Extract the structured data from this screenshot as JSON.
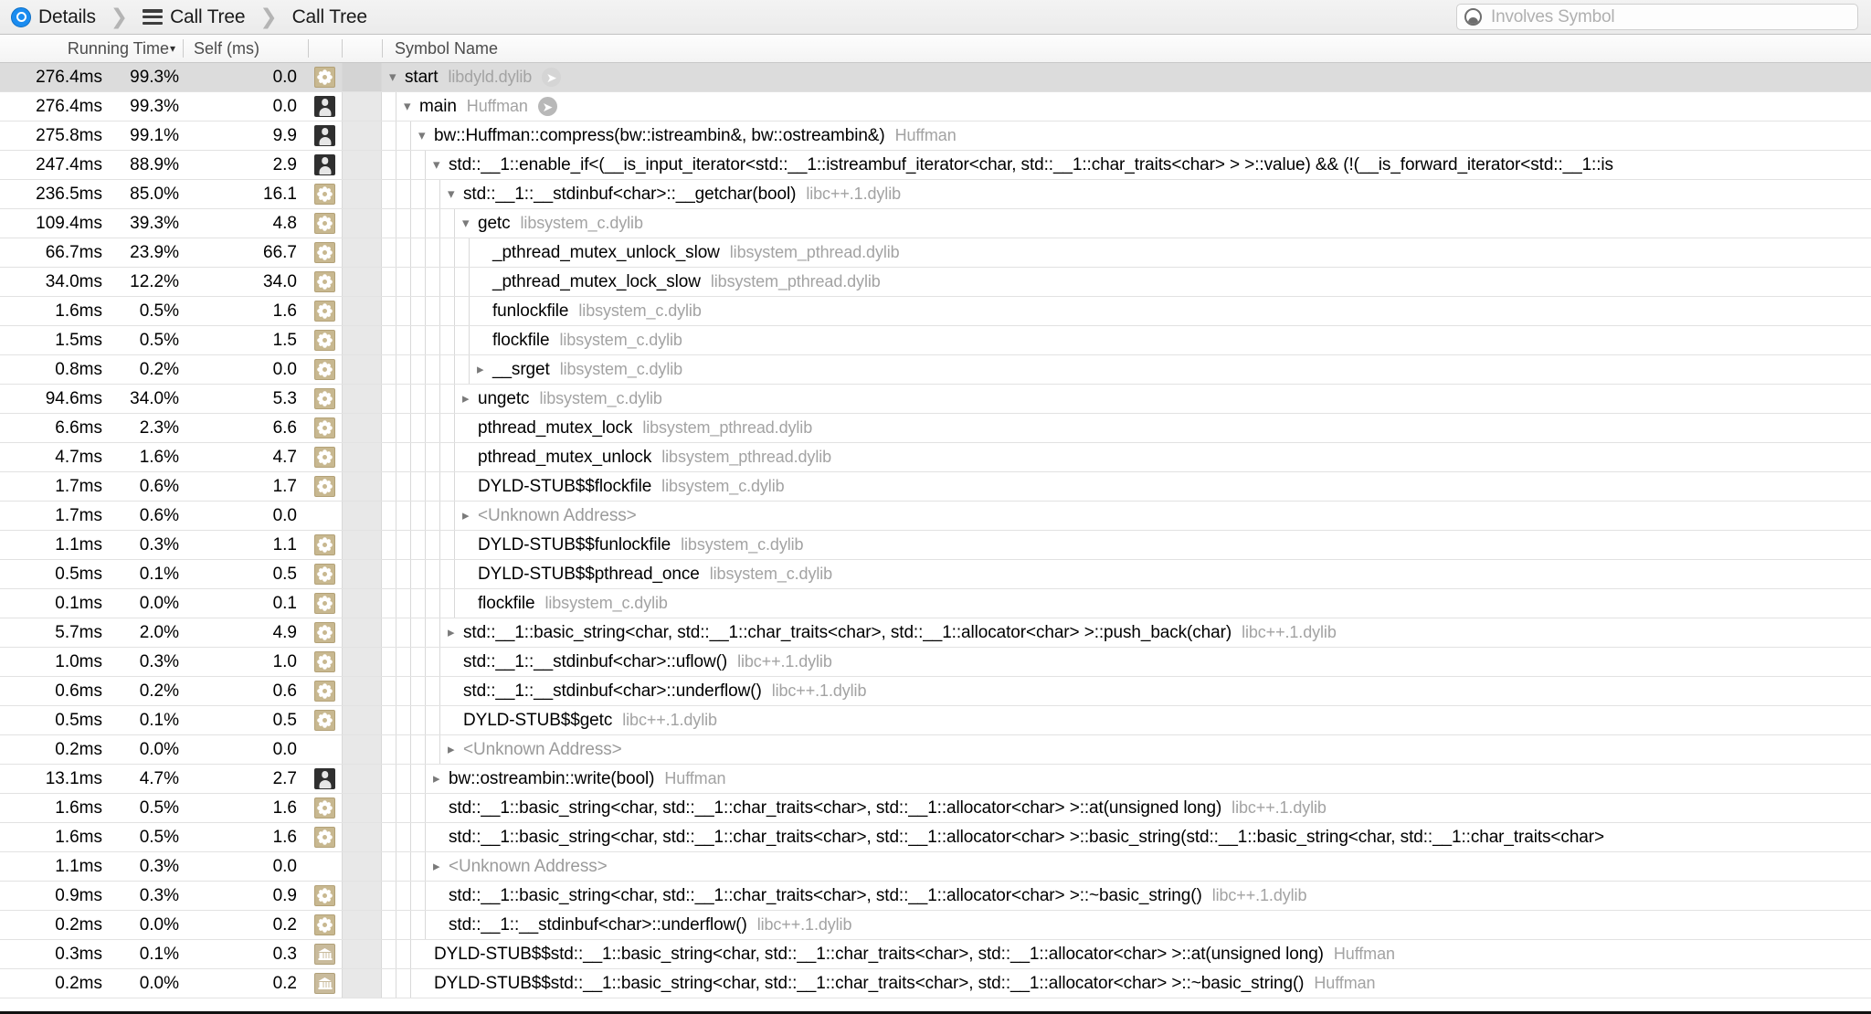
{
  "window": {
    "breadcrumb": [
      {
        "label": "Details",
        "icon": "details-target-icon"
      },
      {
        "label": "Call Tree",
        "icon": "call-tree-icon"
      },
      {
        "label": "Call Tree",
        "icon": null
      }
    ],
    "search": {
      "placeholder": "Involves Symbol",
      "value": "",
      "icon": "symbol-filter-icon"
    }
  },
  "table": {
    "columns": [
      {
        "key": "running_time",
        "label": "Running Time",
        "sorted": true,
        "sort_caret": "▾"
      },
      {
        "key": "self_ms",
        "label": "Self (ms)",
        "sorted": false
      },
      {
        "key": "symbol_name",
        "label": "Symbol Name",
        "sorted": false
      }
    ],
    "rows": [
      {
        "ms": "276.4ms",
        "pct": "99.3%",
        "self": "0.0",
        "icon": "gear",
        "depth": 0,
        "tri": "open",
        "symbol": "start",
        "lib": "libdyld.dylib",
        "go": "pale",
        "selected": true
      },
      {
        "ms": "276.4ms",
        "pct": "99.3%",
        "self": "0.0",
        "icon": "person",
        "depth": 1,
        "tri": "open",
        "symbol": "main",
        "lib": "Huffman",
        "go": "solid",
        "selected": false
      },
      {
        "ms": "275.8ms",
        "pct": "99.1%",
        "self": "9.9",
        "icon": "person",
        "depth": 2,
        "tri": "open",
        "symbol": "bw::Huffman::compress(bw::istreambin&, bw::ostreambin&)",
        "lib": "Huffman",
        "go": null,
        "selected": false
      },
      {
        "ms": "247.4ms",
        "pct": "88.9%",
        "self": "2.9",
        "icon": "person",
        "depth": 3,
        "tri": "open",
        "symbol": "std::__1::enable_if<(__is_input_iterator<std::__1::istreambuf_iterator<char, std::__1::char_traits<char> > >::value) && (!(__is_forward_iterator<std::__1::is",
        "lib": "",
        "go": null,
        "selected": false
      },
      {
        "ms": "236.5ms",
        "pct": "85.0%",
        "self": "16.1",
        "icon": "gear",
        "depth": 4,
        "tri": "open",
        "symbol": "std::__1::__stdinbuf<char>::__getchar(bool)",
        "lib": "libc++.1.dylib",
        "go": null,
        "selected": false
      },
      {
        "ms": "109.4ms",
        "pct": "39.3%",
        "self": "4.8",
        "icon": "gear",
        "depth": 5,
        "tri": "open",
        "symbol": "getc",
        "lib": "libsystem_c.dylib",
        "go": null,
        "selected": false
      },
      {
        "ms": "66.7ms",
        "pct": "23.9%",
        "self": "66.7",
        "icon": "gear",
        "depth": 6,
        "tri": "none",
        "symbol": "_pthread_mutex_unlock_slow",
        "lib": "libsystem_pthread.dylib",
        "go": null,
        "selected": false
      },
      {
        "ms": "34.0ms",
        "pct": "12.2%",
        "self": "34.0",
        "icon": "gear",
        "depth": 6,
        "tri": "none",
        "symbol": "_pthread_mutex_lock_slow",
        "lib": "libsystem_pthread.dylib",
        "go": null,
        "selected": false
      },
      {
        "ms": "1.6ms",
        "pct": "0.5%",
        "self": "1.6",
        "icon": "gear",
        "depth": 6,
        "tri": "none",
        "symbol": "funlockfile",
        "lib": "libsystem_c.dylib",
        "go": null,
        "selected": false
      },
      {
        "ms": "1.5ms",
        "pct": "0.5%",
        "self": "1.5",
        "icon": "gear",
        "depth": 6,
        "tri": "none",
        "symbol": "flockfile",
        "lib": "libsystem_c.dylib",
        "go": null,
        "selected": false
      },
      {
        "ms": "0.8ms",
        "pct": "0.2%",
        "self": "0.0",
        "icon": "gear",
        "depth": 6,
        "tri": "closed",
        "symbol": "__srget",
        "lib": "libsystem_c.dylib",
        "go": null,
        "selected": false
      },
      {
        "ms": "94.6ms",
        "pct": "34.0%",
        "self": "5.3",
        "icon": "gear",
        "depth": 5,
        "tri": "closed",
        "symbol": "ungetc",
        "lib": "libsystem_c.dylib",
        "go": null,
        "selected": false
      },
      {
        "ms": "6.6ms",
        "pct": "2.3%",
        "self": "6.6",
        "icon": "gear",
        "depth": 5,
        "tri": "none",
        "symbol": "pthread_mutex_lock",
        "lib": "libsystem_pthread.dylib",
        "go": null,
        "selected": false
      },
      {
        "ms": "4.7ms",
        "pct": "1.6%",
        "self": "4.7",
        "icon": "gear",
        "depth": 5,
        "tri": "none",
        "symbol": "pthread_mutex_unlock",
        "lib": "libsystem_pthread.dylib",
        "go": null,
        "selected": false
      },
      {
        "ms": "1.7ms",
        "pct": "0.6%",
        "self": "1.7",
        "icon": "gear",
        "depth": 5,
        "tri": "none",
        "symbol": "DYLD-STUB$$flockfile",
        "lib": "libsystem_c.dylib",
        "go": null,
        "selected": false
      },
      {
        "ms": "1.7ms",
        "pct": "0.6%",
        "self": "0.0",
        "icon": "none",
        "depth": 5,
        "tri": "closed",
        "symbol": "<Unknown Address>",
        "lib": "",
        "go": null,
        "unknown": true,
        "selected": false
      },
      {
        "ms": "1.1ms",
        "pct": "0.3%",
        "self": "1.1",
        "icon": "gear",
        "depth": 5,
        "tri": "none",
        "symbol": "DYLD-STUB$$funlockfile",
        "lib": "libsystem_c.dylib",
        "go": null,
        "selected": false
      },
      {
        "ms": "0.5ms",
        "pct": "0.1%",
        "self": "0.5",
        "icon": "gear",
        "depth": 5,
        "tri": "none",
        "symbol": "DYLD-STUB$$pthread_once",
        "lib": "libsystem_c.dylib",
        "go": null,
        "selected": false
      },
      {
        "ms": "0.1ms",
        "pct": "0.0%",
        "self": "0.1",
        "icon": "gear",
        "depth": 5,
        "tri": "none",
        "symbol": "flockfile",
        "lib": "libsystem_c.dylib",
        "go": null,
        "selected": false
      },
      {
        "ms": "5.7ms",
        "pct": "2.0%",
        "self": "4.9",
        "icon": "gear",
        "depth": 4,
        "tri": "closed",
        "symbol": "std::__1::basic_string<char, std::__1::char_traits<char>, std::__1::allocator<char> >::push_back(char)",
        "lib": "libc++.1.dylib",
        "go": null,
        "selected": false
      },
      {
        "ms": "1.0ms",
        "pct": "0.3%",
        "self": "1.0",
        "icon": "gear",
        "depth": 4,
        "tri": "none",
        "symbol": "std::__1::__stdinbuf<char>::uflow()",
        "lib": "libc++.1.dylib",
        "go": null,
        "selected": false
      },
      {
        "ms": "0.6ms",
        "pct": "0.2%",
        "self": "0.6",
        "icon": "gear",
        "depth": 4,
        "tri": "none",
        "symbol": "std::__1::__stdinbuf<char>::underflow()",
        "lib": "libc++.1.dylib",
        "go": null,
        "selected": false
      },
      {
        "ms": "0.5ms",
        "pct": "0.1%",
        "self": "0.5",
        "icon": "gear",
        "depth": 4,
        "tri": "none",
        "symbol": "DYLD-STUB$$getc",
        "lib": "libc++.1.dylib",
        "go": null,
        "selected": false
      },
      {
        "ms": "0.2ms",
        "pct": "0.0%",
        "self": "0.0",
        "icon": "none",
        "depth": 4,
        "tri": "closed",
        "symbol": "<Unknown Address>",
        "lib": "",
        "go": null,
        "unknown": true,
        "selected": false
      },
      {
        "ms": "13.1ms",
        "pct": "4.7%",
        "self": "2.7",
        "icon": "person",
        "depth": 3,
        "tri": "closed",
        "symbol": "bw::ostreambin::write(bool)",
        "lib": "Huffman",
        "go": null,
        "selected": false
      },
      {
        "ms": "1.6ms",
        "pct": "0.5%",
        "self": "1.6",
        "icon": "gear",
        "depth": 3,
        "tri": "none",
        "symbol": "std::__1::basic_string<char, std::__1::char_traits<char>, std::__1::allocator<char> >::at(unsigned long)",
        "lib": "libc++.1.dylib",
        "go": null,
        "selected": false
      },
      {
        "ms": "1.6ms",
        "pct": "0.5%",
        "self": "1.6",
        "icon": "gear",
        "depth": 3,
        "tri": "none",
        "symbol": "std::__1::basic_string<char, std::__1::char_traits<char>, std::__1::allocator<char> >::basic_string(std::__1::basic_string<char, std::__1::char_traits<char>",
        "lib": "",
        "go": null,
        "selected": false
      },
      {
        "ms": "1.1ms",
        "pct": "0.3%",
        "self": "0.0",
        "icon": "none",
        "depth": 3,
        "tri": "closed",
        "symbol": "<Unknown Address>",
        "lib": "",
        "go": null,
        "unknown": true,
        "selected": false
      },
      {
        "ms": "0.9ms",
        "pct": "0.3%",
        "self": "0.9",
        "icon": "gear",
        "depth": 3,
        "tri": "none",
        "symbol": "std::__1::basic_string<char, std::__1::char_traits<char>, std::__1::allocator<char> >::~basic_string()",
        "lib": "libc++.1.dylib",
        "go": null,
        "selected": false
      },
      {
        "ms": "0.2ms",
        "pct": "0.0%",
        "self": "0.2",
        "icon": "gear",
        "depth": 3,
        "tri": "none",
        "symbol": "std::__1::__stdinbuf<char>::underflow()",
        "lib": "libc++.1.dylib",
        "go": null,
        "selected": false
      },
      {
        "ms": "0.3ms",
        "pct": "0.1%",
        "self": "0.3",
        "icon": "lib",
        "depth": 2,
        "tri": "none",
        "symbol": "DYLD-STUB$$std::__1::basic_string<char, std::__1::char_traits<char>, std::__1::allocator<char> >::at(unsigned long)",
        "lib": "Huffman",
        "go": null,
        "selected": false
      },
      {
        "ms": "0.2ms",
        "pct": "0.0%",
        "self": "0.2",
        "icon": "lib",
        "depth": 2,
        "tri": "none",
        "symbol": "DYLD-STUB$$std::__1::basic_string<char, std::__1::char_traits<char>, std::__1::allocator<char> >::~basic_string()",
        "lib": "Huffman",
        "go": null,
        "selected": false
      }
    ]
  }
}
